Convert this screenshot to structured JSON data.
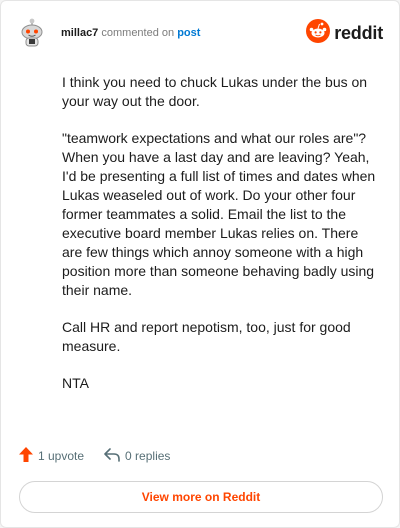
{
  "header": {
    "username": "millac7",
    "action_text": "commented on",
    "link_text": "post",
    "brand_name": "reddit"
  },
  "comment": {
    "paragraphs": [
      "I think you need to chuck Lukas under the bus on your way out the door.",
      "\"teamwork expectations and what our roles are\"? When you have a last day and are leaving? Yeah, I'd be presenting a full list of times and dates when Lukas weaseled out of work. Do your other four former teammates a solid. Email the list to the executive board member Lukas relies on. There are few things which annoy someone with a high position more than someone behaving badly using their name.",
      "Call HR and report nepotism, too, just for good measure.",
      "NTA"
    ]
  },
  "actions": {
    "upvote_label": "1 upvote",
    "replies_label": "0 replies"
  },
  "footer": {
    "view_more_label": "View more on Reddit"
  },
  "colors": {
    "brand_orange": "#ff4500",
    "link_blue": "#0079d3",
    "muted_text": "#7c7c7c"
  },
  "icons": {
    "avatar": "snoo-avatar-icon",
    "brand": "reddit-logo-icon",
    "upvote": "upvote-arrow-icon",
    "reply": "reply-arrow-icon"
  }
}
